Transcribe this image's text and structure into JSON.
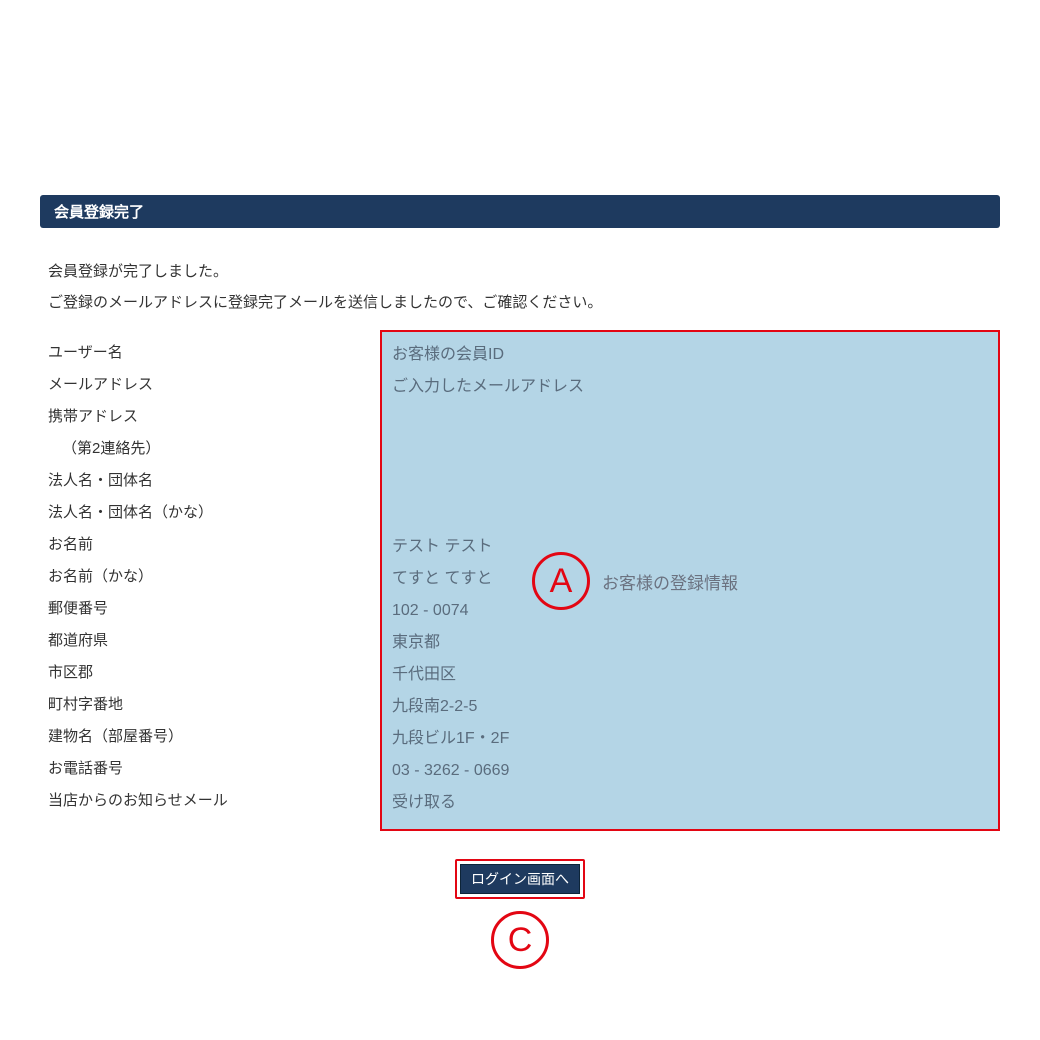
{
  "header": {
    "title": "会員登録完了"
  },
  "messages": {
    "line1": "会員登録が完了しました。",
    "line2": "ご登録のメールアドレスに登録完了メールを送信しましたので、ご確認ください。"
  },
  "labels": {
    "username": "ユーザー名",
    "email": "メールアドレス",
    "mobile": "携帯アドレス",
    "mobile_sub": "（第2連絡先）",
    "corp": "法人名・団体名",
    "corp_kana": "法人名・団体名（かな）",
    "name": "お名前",
    "name_kana": "お名前（かな）",
    "postal": "郵便番号",
    "prefecture": "都道府県",
    "city": "市区郡",
    "address": "町村字番地",
    "building": "建物名（部屋番号）",
    "phone": "お電話番号",
    "newsletter": "当店からのお知らせメール"
  },
  "values": {
    "username": "お客様の会員ID",
    "email": "ご入力したメールアドレス",
    "mobile": "",
    "mobile_sub": "",
    "corp": "",
    "corp_kana": "",
    "name": "テスト テスト",
    "name_kana": "てすと てすと",
    "postal": "102 - 0074",
    "prefecture": "東京都",
    "city": "千代田区",
    "address": "九段南2-2-5",
    "building": "九段ビル1F・2F",
    "phone": "03 - 3262 - 0669",
    "newsletter": "受け取る"
  },
  "annotations": {
    "a_letter": "A",
    "a_text": "お客様の登録情報",
    "c_letter": "C"
  },
  "button": {
    "login": "ログイン画面へ"
  }
}
